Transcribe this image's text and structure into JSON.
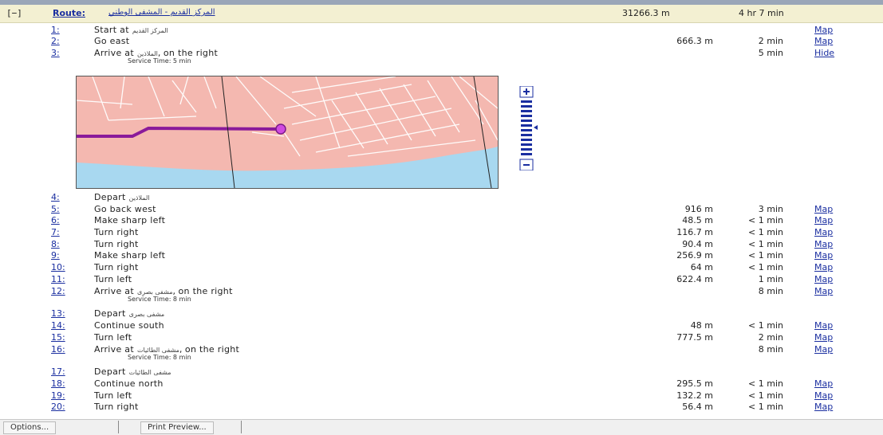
{
  "route": {
    "collapse_label": "[−]",
    "label": "Route:",
    "name": "المركز القديم - المشفى الوطني",
    "distance": "31266.3 m",
    "time": "4 hr 7 min"
  },
  "service_time_label": "Service Time: 5 min",
  "service_time_label_8": "Service Time: 8 min",
  "steps": [
    {
      "num": "1:",
      "text": "Start at",
      "arabic": "المركز القديم",
      "suffix": "",
      "dist": "",
      "time": "",
      "link": "Map"
    },
    {
      "num": "2:",
      "text": "Go east",
      "arabic": "",
      "suffix": "",
      "dist": "666.3 m",
      "time": "2 min",
      "link": "Map"
    },
    {
      "num": "3:",
      "text": "Arrive at",
      "arabic": "الملاذين",
      "suffix": ", on the right",
      "dist": "",
      "time": "5 min",
      "link": "Hide"
    },
    {
      "num": "4:",
      "text": "Depart",
      "arabic": "الملاذين",
      "suffix": "",
      "dist": "",
      "time": "",
      "link": ""
    },
    {
      "num": "5:",
      "text": "Go back west",
      "arabic": "",
      "suffix": "",
      "dist": "916 m",
      "time": "3 min",
      "link": "Map"
    },
    {
      "num": "6:",
      "text": "Make sharp left",
      "arabic": "",
      "suffix": "",
      "dist": "48.5 m",
      "time": "< 1 min",
      "link": "Map"
    },
    {
      "num": "7:",
      "text": "Turn right",
      "arabic": "",
      "suffix": "",
      "dist": "116.7 m",
      "time": "< 1 min",
      "link": "Map"
    },
    {
      "num": "8:",
      "text": "Turn right",
      "arabic": "",
      "suffix": "",
      "dist": "90.4 m",
      "time": "< 1 min",
      "link": "Map"
    },
    {
      "num": "9:",
      "text": "Make sharp left",
      "arabic": "",
      "suffix": "",
      "dist": "256.9 m",
      "time": "< 1 min",
      "link": "Map"
    },
    {
      "num": "10:",
      "text": "Turn right",
      "arabic": "",
      "suffix": "",
      "dist": "64 m",
      "time": "< 1 min",
      "link": "Map"
    },
    {
      "num": "11:",
      "text": "Turn left",
      "arabic": "",
      "suffix": "",
      "dist": "622.4 m",
      "time": "1 min",
      "link": "Map"
    },
    {
      "num": "12:",
      "text": "Arrive at",
      "arabic": "مشفى بصرى",
      "suffix": ", on the right",
      "dist": "",
      "time": "8 min",
      "link": "Map"
    },
    {
      "num": "13:",
      "text": "Depart",
      "arabic": "مشفى بصرى",
      "suffix": "",
      "dist": "",
      "time": "",
      "link": ""
    },
    {
      "num": "14:",
      "text": "Continue south",
      "arabic": "",
      "suffix": "",
      "dist": "48 m",
      "time": "< 1 min",
      "link": "Map"
    },
    {
      "num": "15:",
      "text": "Turn left",
      "arabic": "",
      "suffix": "",
      "dist": "777.5 m",
      "time": "2 min",
      "link": "Map"
    },
    {
      "num": "16:",
      "text": "Arrive at",
      "arabic": "مشفى الطائيات",
      "suffix": ", on the right",
      "dist": "",
      "time": "8 min",
      "link": "Map"
    },
    {
      "num": "17:",
      "text": "Depart",
      "arabic": "مشفى الطائيات",
      "suffix": "",
      "dist": "",
      "time": "",
      "link": ""
    },
    {
      "num": "18:",
      "text": "Continue north",
      "arabic": "",
      "suffix": "",
      "dist": "295.5 m",
      "time": "< 1 min",
      "link": "Map"
    },
    {
      "num": "19:",
      "text": "Turn left",
      "arabic": "",
      "suffix": "",
      "dist": "132.2 m",
      "time": "< 1 min",
      "link": "Map"
    },
    {
      "num": "20:",
      "text": "Turn right",
      "arabic": "",
      "suffix": "",
      "dist": "56.4 m",
      "time": "< 1 min",
      "link": "Map"
    }
  ],
  "toolbar": {
    "options_label": "Options...",
    "preview_label": "Print Preview..."
  },
  "colors": {
    "link": "#1a2ea0",
    "route_line": "#8a1a9a",
    "map_land": "#f4b8b0",
    "map_water": "#a8d8f0",
    "header_bg": "#f3f0d2"
  }
}
